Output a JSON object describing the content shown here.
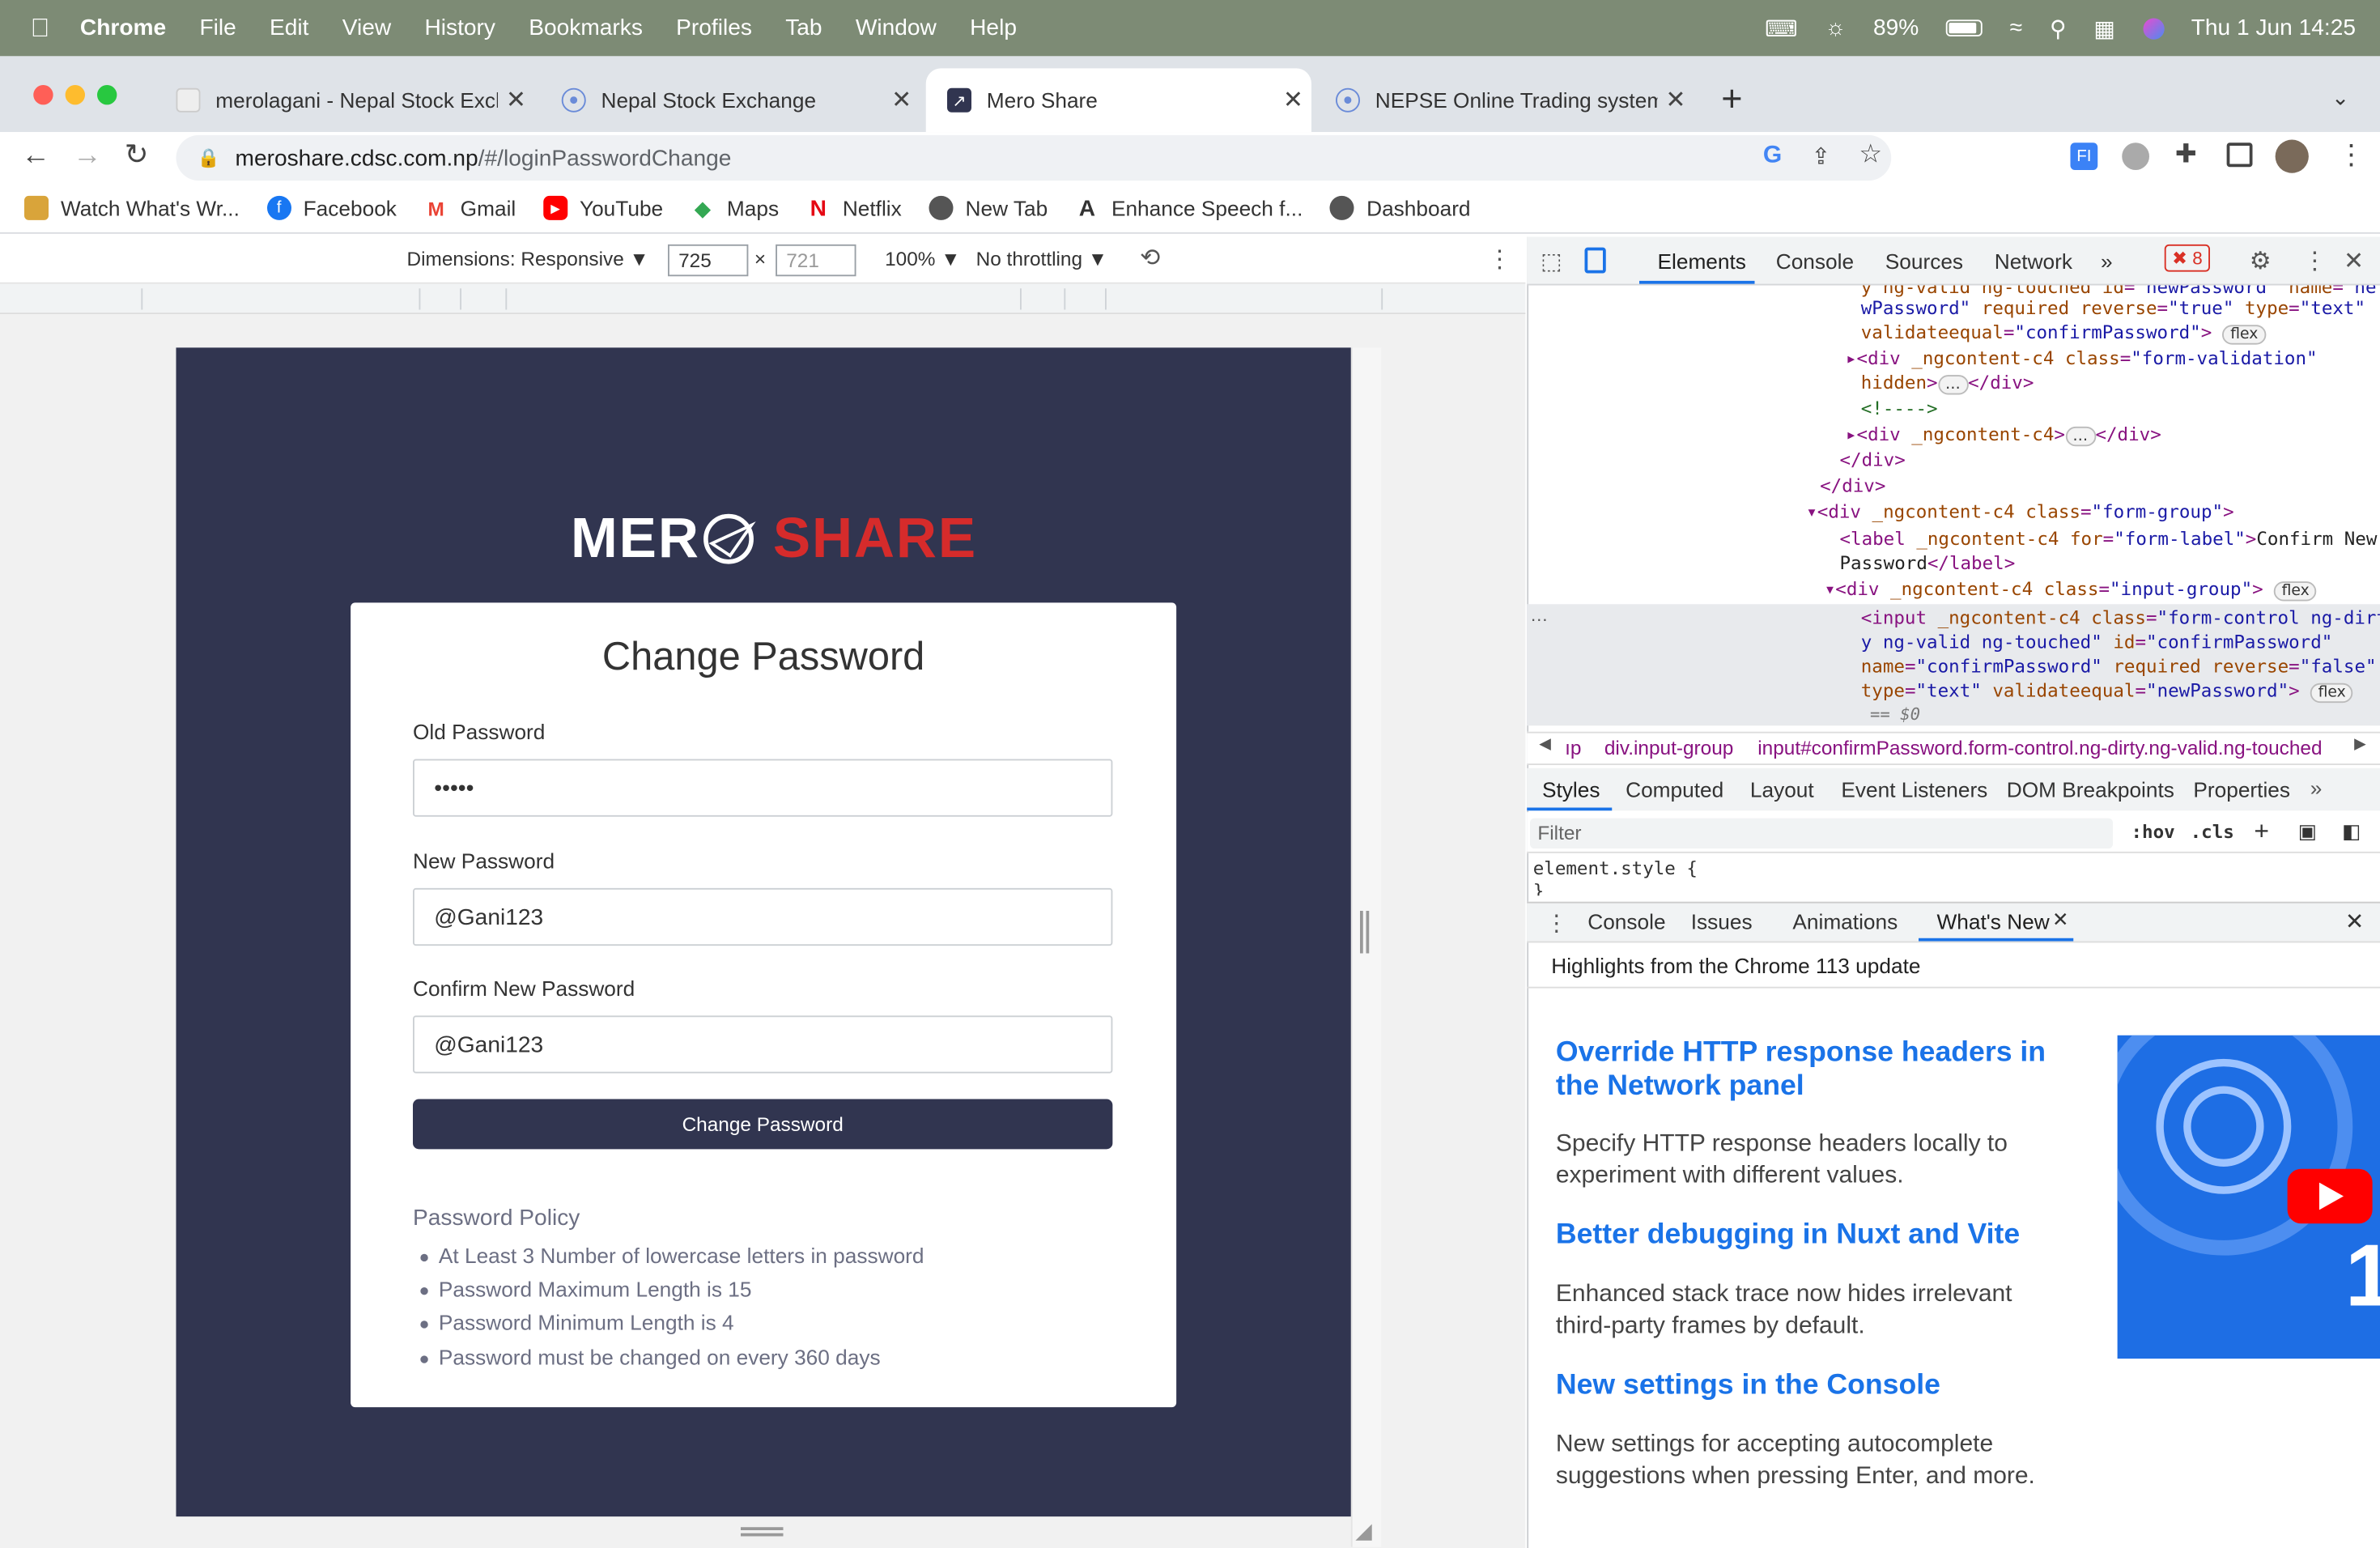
{
  "menubar": {
    "app": "Chrome",
    "items": [
      "File",
      "Edit",
      "View",
      "History",
      "Bookmarks",
      "Profiles",
      "Tab",
      "Window",
      "Help"
    ],
    "battery": "89%",
    "datetime": "Thu 1 Jun  14:25"
  },
  "tabs": [
    {
      "title": "merolagani - Nepal Stock Exch"
    },
    {
      "title": "Nepal Stock Exchange"
    },
    {
      "title": "Mero Share"
    },
    {
      "title": "NEPSE Online Trading system"
    }
  ],
  "address": {
    "host": "meroshare.cdsc.com.np",
    "path": "/#/loginPasswordChange"
  },
  "bookmarks": [
    "Watch What's Wr...",
    "Facebook",
    "Gmail",
    "YouTube",
    "Maps",
    "Netflix",
    "New Tab",
    "Enhance Speech f...",
    "Dashboard"
  ],
  "device_toolbar": {
    "dimensions": "Dimensions: Responsive ▼",
    "width": "725",
    "height": "721",
    "zoom": "100% ▼",
    "throttling": "No throttling ▼"
  },
  "page": {
    "logo_left": "MER",
    "logo_right": "SHARE",
    "title": "Change Password",
    "old_label": "Old Password",
    "old_value": "•••••",
    "new_label": "New Password",
    "new_value": "@Gani123",
    "confirm_label": "Confirm New Password",
    "confirm_value": "@Gani123",
    "button": "Change Password",
    "policy_title": "Password Policy",
    "policy": [
      "At Least 3 Number of lowercase letters in password",
      "Password Maximum Length is 15",
      "Password Minimum Length is 4",
      "Password must be changed on every 360 days"
    ]
  },
  "devtools": {
    "tabs": [
      "Elements",
      "Console",
      "Sources",
      "Network"
    ],
    "error_count": "8",
    "crumbs": [
      "ıp",
      "div.input-group",
      "input#confirmPassword.form-control.ng-dirty.ng-valid.ng-touched"
    ],
    "subtabs": [
      "Styles",
      "Computed",
      "Layout",
      "Event Listeners",
      "DOM Breakpoints",
      "Properties"
    ],
    "filter_placeholder": "Filter",
    "hov": ":hov",
    "cls": ".cls",
    "element_style": "element.style {",
    "drawer_tabs": [
      "Console",
      "Issues",
      "Animations",
      "What's New"
    ],
    "whats_new_header": "Highlights from the Chrome 113 update",
    "articles": [
      {
        "title": "Override HTTP response headers in the Network panel",
        "desc": "Specify HTTP response headers locally to experiment with different values."
      },
      {
        "title": "Better debugging in Nuxt and Vite",
        "desc": "Enhanced stack trace now hides irrelevant third-party frames by default."
      },
      {
        "title": "New settings in the Console",
        "desc": "New settings for accepting autocomplete suggestions when pressing Enter, and more."
      }
    ]
  },
  "colors": {
    "page_bg": "#313550",
    "share_red": "#d62b2b",
    "link_blue": "#1a73e8"
  }
}
